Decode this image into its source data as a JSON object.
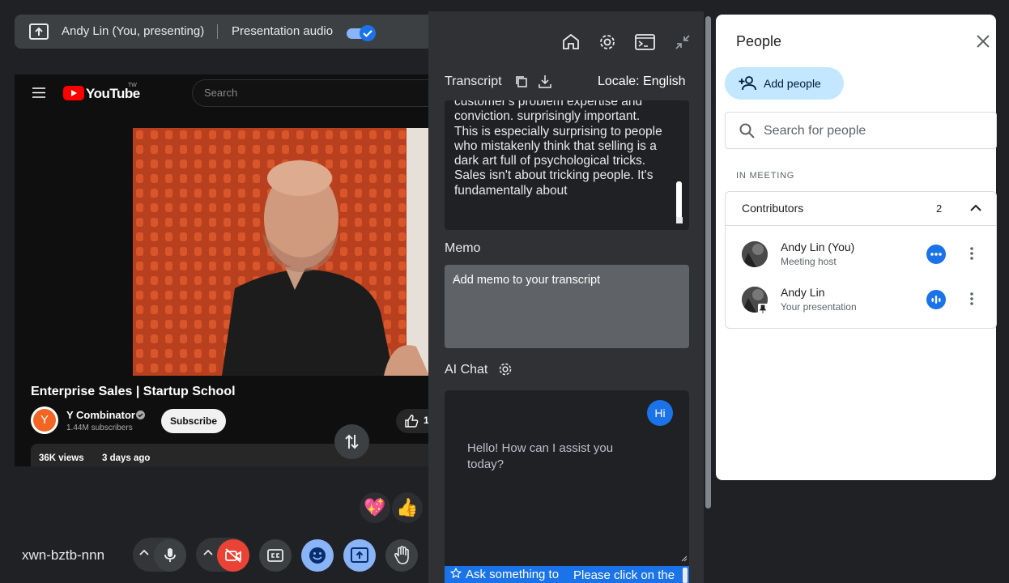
{
  "presenting_bar": {
    "presenter": "Andy Lin (You, presenting)",
    "audio_label": "Presentation audio",
    "audio_enabled": true
  },
  "youtube": {
    "logo_text": "YouTube",
    "logo_sup": "TW",
    "search_placeholder": "Search",
    "video_title": "Enterprise Sales | Startup School",
    "channel_name": "Y Combinator",
    "channel_initial": "Y",
    "subscribers": "1.44M subscribers",
    "subscribe_label": "Subscribe",
    "like_count": "1",
    "views": "36K views",
    "posted": "3 days ago"
  },
  "transcript_panel": {
    "transcript_label": "Transcript",
    "locale": "Locale: English",
    "transcript_text": "customer's problem expertise and conviction. surprisingly important. This is especially surprising to people who mistakenly think that selling is a dark art full of psychological tricks. Sales isn't about tricking people. It's fundamentally about",
    "memo_label": "Memo",
    "memo_placeholder": "Add memo to your transcript",
    "ai_chat_label": "AI Chat",
    "chat_user_message": "Hi",
    "chat_assistant_message": "Hello! How can I assist you today?",
    "ask_placeholder": "Ask something to",
    "ask_hint": "Please click on the"
  },
  "people_panel": {
    "title": "People",
    "add_people_label": "Add people",
    "search_placeholder": "Search for people",
    "section_label": "IN MEETING",
    "group_label": "Contributors",
    "group_count": "2",
    "participants": [
      {
        "name": "Andy Lin (You)",
        "role": "Meeting host"
      },
      {
        "name": "Andy Lin",
        "role": "Your presentation"
      }
    ]
  },
  "controls": {
    "meeting_code": "xwn-bztb-nnn"
  },
  "reactions": [
    "💖",
    "👍"
  ],
  "colors": {
    "accent": "#1a73e8",
    "add_people_bg": "#c2e7ff",
    "camera_off": "#ea4335",
    "active_control": "#8ab4f8"
  }
}
